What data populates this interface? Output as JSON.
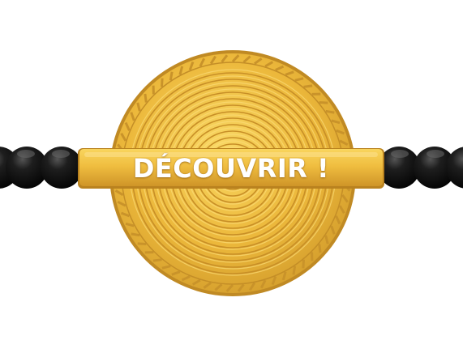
{
  "cta": {
    "label": "DÉCOUVRIR !"
  },
  "colors": {
    "coin_light": "#f7cf57",
    "coin_mid": "#eab537",
    "coin_dark": "#d09a2a",
    "coin_outline": "#c08a24",
    "bar_light": "#f6cb4e",
    "bar_dark": "#d79f2c",
    "bead": "#141414",
    "bead_highlight": "#6a6a6a",
    "label_text": "#ffffff"
  },
  "icons": {
    "medallion": "golden-coin-icon",
    "beads_left": "black-bead-strand-icon",
    "beads_right": "black-bead-strand-icon"
  }
}
